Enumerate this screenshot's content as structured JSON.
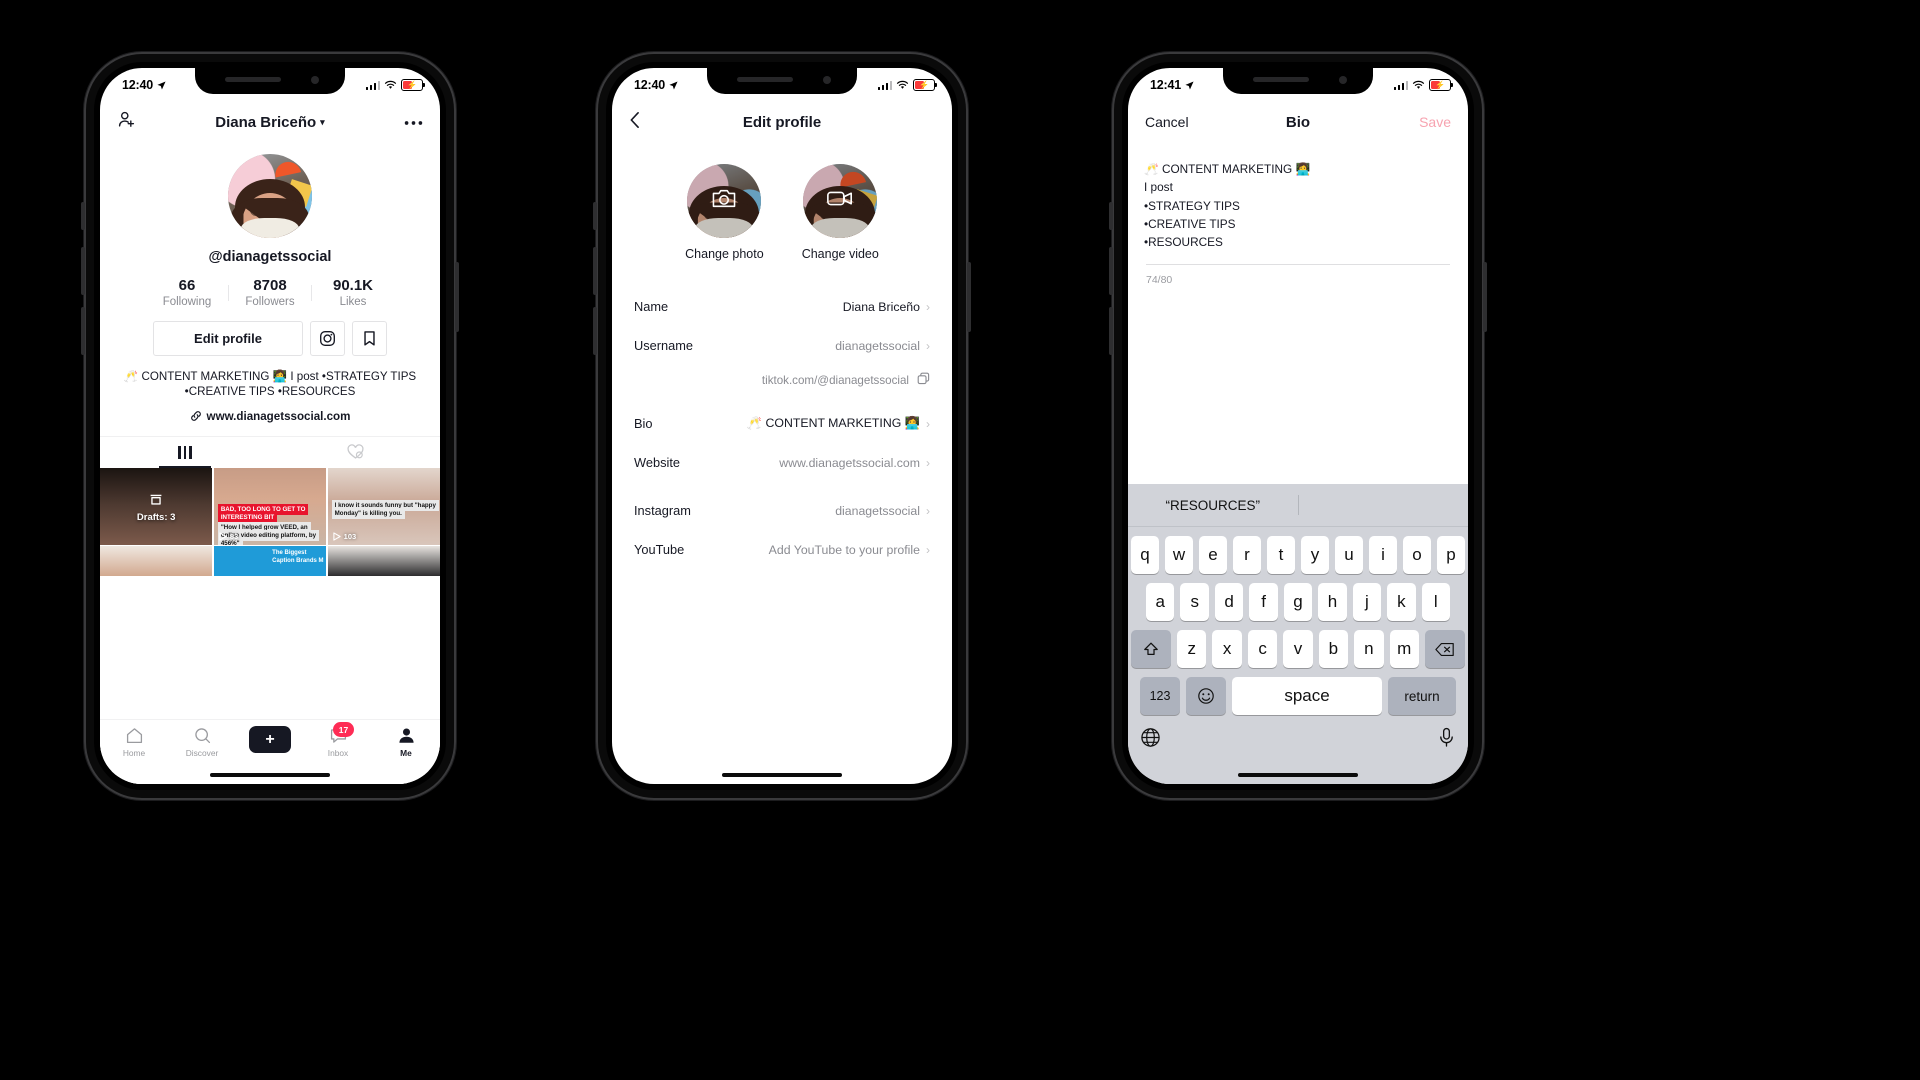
{
  "phones": [
    {
      "id": "profile",
      "status": {
        "time": "12:40",
        "location_icon": "location-arrow",
        "wifi": "wifi-icon",
        "battery_icon": "battery-charging"
      },
      "header": {
        "left_icon": "add-person-icon",
        "title": "Diana Briceño",
        "caret": "▾",
        "right_icon": "more-options-icon"
      },
      "handle": "@dianagetssocial",
      "stats": [
        {
          "num": "66",
          "label": "Following"
        },
        {
          "num": "8708",
          "label": "Followers"
        },
        {
          "num": "90.1K",
          "label": "Likes"
        }
      ],
      "actions": {
        "edit": "Edit profile",
        "instagram_icon": "instagram-icon",
        "bookmark_icon": "bookmark-icon"
      },
      "bio": "🥂 CONTENT MARKETING 👩‍💻\nI post\n•STRATEGY TIPS\n•CREATIVE TIPS\n•RESOURCES",
      "website": "www.dianagetssocial.com",
      "website_icon": "link-icon",
      "tabs": [
        {
          "icon": "grid-icon",
          "active": true
        },
        {
          "icon": "private-liked-icon",
          "active": false
        }
      ],
      "grid": [
        {
          "drafts_label": "Drafts: 3",
          "drafts_icon": "drafts-icon"
        },
        {
          "caption_red": "BAD, TOO LONG TO GET TO INTERESTING BIT",
          "caption_white": "\"How I helped grow VEED, an online video editing platform, by 456%\"",
          "plays": "83"
        },
        {
          "caption_white": "I know it sounds funny but \"happy Monday\" is killing you.",
          "plays": "103"
        },
        {},
        {
          "caption_white": "The Biggest Caption Brands M"
        },
        {}
      ],
      "tabbar": [
        {
          "label": "Home",
          "icon": "home-icon",
          "selected": false
        },
        {
          "label": "Discover",
          "icon": "search-icon",
          "selected": false
        },
        {
          "label": "",
          "icon": "create-plus-button",
          "selected": false
        },
        {
          "label": "Inbox",
          "icon": "inbox-icon",
          "badge": "17",
          "selected": false
        },
        {
          "label": "Me",
          "icon": "profile-icon",
          "selected": true
        }
      ]
    },
    {
      "id": "edit-profile",
      "status": {
        "time": "12:40"
      },
      "header": {
        "back_icon": "back-chevron-icon",
        "title": "Edit profile"
      },
      "media": [
        {
          "label": "Change photo",
          "icon": "camera-icon"
        },
        {
          "label": "Change video",
          "icon": "video-icon"
        }
      ],
      "rows": [
        {
          "key": "Name",
          "value": "Diana Briceño",
          "dark": true
        },
        {
          "key": "Username",
          "value": "dianagetssocial",
          "dark": false
        },
        {
          "sub": "tiktok.com/@dianagetssocial",
          "copy_icon": "copy-icon"
        },
        {
          "key": "Bio",
          "value": "🥂 CONTENT MARKETING 👩‍💻",
          "dark": true
        },
        {
          "key": "Website",
          "value": "www.dianagetssocial.com",
          "dark": false
        },
        {
          "key": "Instagram",
          "value": "dianagetssocial",
          "dark": false
        },
        {
          "key": "YouTube",
          "value": "Add YouTube to your profile",
          "dark": false
        }
      ]
    },
    {
      "id": "bio-editor",
      "status": {
        "time": "12:41"
      },
      "header": {
        "cancel": "Cancel",
        "title": "Bio",
        "save": "Save"
      },
      "bio_text": "🥂 CONTENT MARKETING 👩‍💻\nI post\n•STRATEGY TIPS\n•CREATIVE TIPS\n•RESOURCES",
      "counter": "74/80",
      "keyboard": {
        "prediction": "“RESOURCES”",
        "row1": [
          "q",
          "w",
          "e",
          "r",
          "t",
          "y",
          "u",
          "i",
          "o",
          "p"
        ],
        "row2": [
          "a",
          "s",
          "d",
          "f",
          "g",
          "h",
          "j",
          "k",
          "l"
        ],
        "row3": [
          "z",
          "x",
          "c",
          "v",
          "b",
          "n",
          "m"
        ],
        "shift_icon": "shift-icon",
        "backspace_icon": "backspace-icon",
        "numbers_key": "123",
        "emoji_icon": "emoji-icon",
        "space_key": "space",
        "return_key": "return",
        "globe_icon": "globe-icon",
        "mic_icon": "microphone-icon"
      }
    }
  ],
  "colors": {
    "accent_red": "#fe2c55",
    "accent_cyan": "#25f4ee",
    "text": "#161823",
    "muted": "#8a8b91"
  }
}
